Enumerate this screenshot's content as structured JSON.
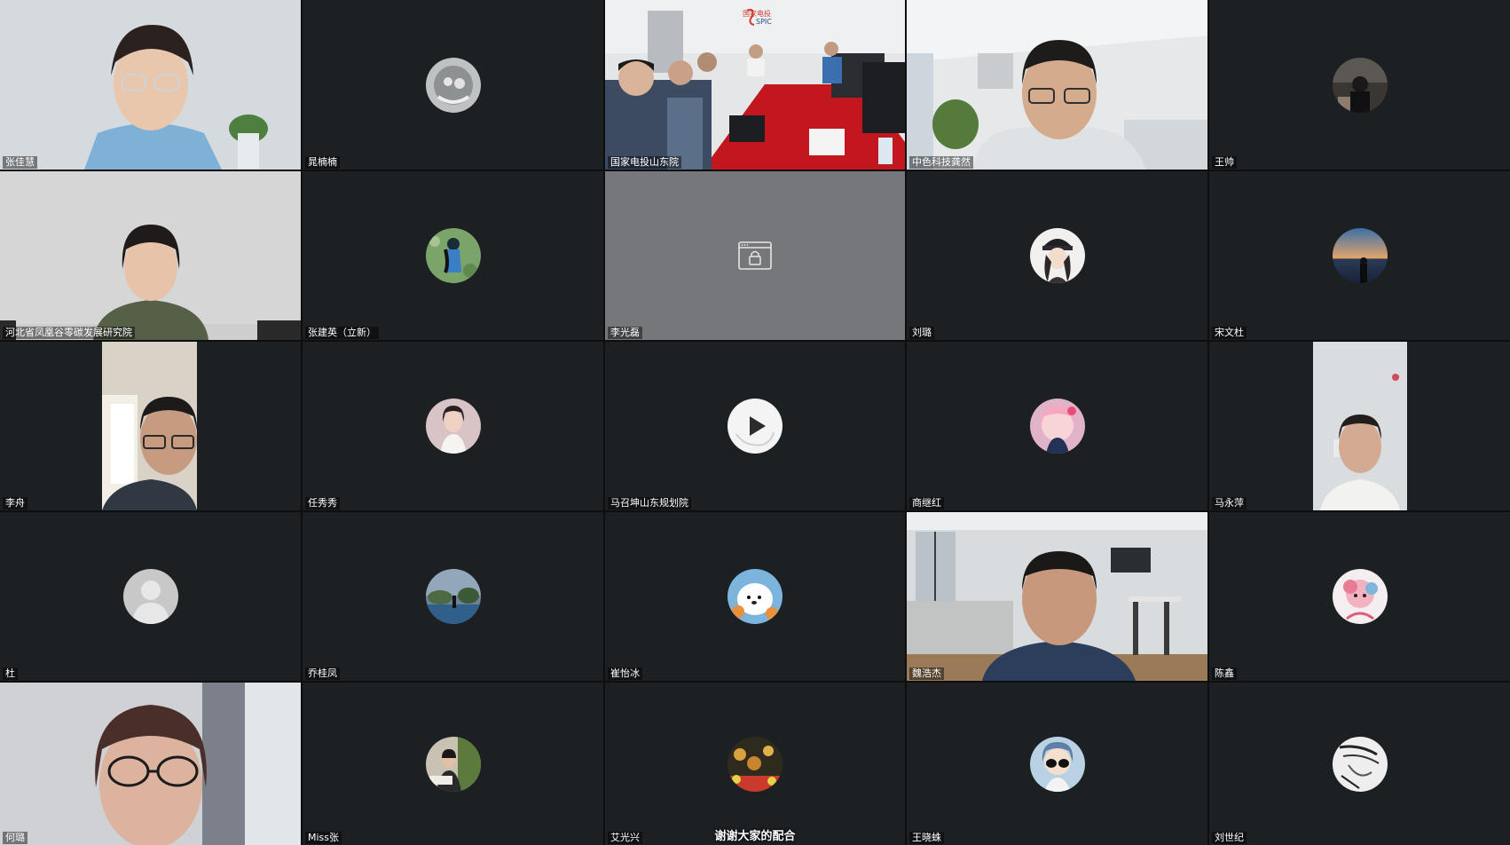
{
  "participants": [
    {
      "name": "张佳慧",
      "type": "video",
      "speaking": true
    },
    {
      "name": "晁楠楠",
      "type": "avatar"
    },
    {
      "name": "国家电投山东院",
      "type": "video"
    },
    {
      "name": "中色科技龚然",
      "type": "video"
    },
    {
      "name": "王帅",
      "type": "avatar"
    },
    {
      "name": "河北省凤凰谷零碳发展研究院",
      "type": "video"
    },
    {
      "name": "张建英（立新）",
      "type": "avatar"
    },
    {
      "name": "李光磊",
      "type": "private"
    },
    {
      "name": "刘璐",
      "type": "avatar"
    },
    {
      "name": "宋文杜",
      "type": "avatar"
    },
    {
      "name": "李舟",
      "type": "video"
    },
    {
      "name": "任秀秀",
      "type": "avatar"
    },
    {
      "name": "马召坤山东规划院",
      "type": "avatar-play"
    },
    {
      "name": "商继红",
      "type": "avatar"
    },
    {
      "name": "马永萍",
      "type": "video"
    },
    {
      "name": "杜",
      "type": "avatar-default"
    },
    {
      "name": "乔桂凤",
      "type": "avatar"
    },
    {
      "name": "崔怡冰",
      "type": "avatar"
    },
    {
      "name": "魏浩杰",
      "type": "video"
    },
    {
      "name": "陈鑫",
      "type": "avatar"
    },
    {
      "name": "何璐",
      "type": "video"
    },
    {
      "name": "Miss张",
      "type": "avatar"
    },
    {
      "name": "艾光兴",
      "type": "avatar"
    },
    {
      "name": "王晓蛛",
      "type": "avatar"
    },
    {
      "name": "刘世纪",
      "type": "avatar"
    }
  ],
  "video_overlay": {
    "logo_cn": "国家电投",
    "logo_en": "SPIC"
  },
  "caption": "谢谢大家的配合",
  "colors": {
    "tile_bg": "#1d2023",
    "gap": "#0c0e10",
    "speaking_border": "#3fae5a",
    "private_tile_bg": "#75777b"
  },
  "icons": {
    "private": "lock-icon",
    "play": "play-icon",
    "default_avatar": "person-silhouette-icon"
  }
}
